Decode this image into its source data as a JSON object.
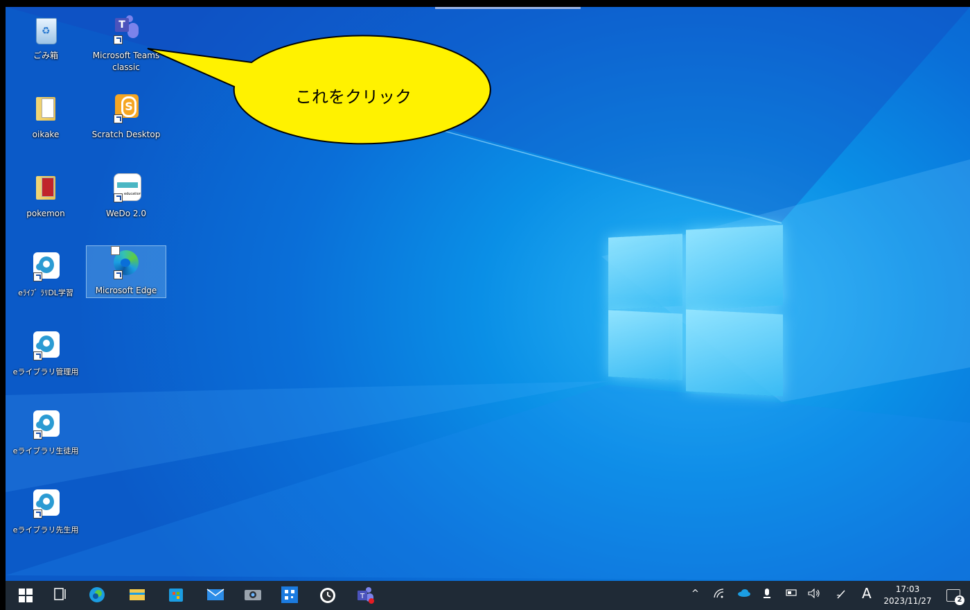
{
  "desktop": {
    "icons": [
      {
        "label": "ごみ箱"
      },
      {
        "label": "Microsoft Teams classic"
      },
      {
        "label": "oikake"
      },
      {
        "label": "Scratch Desktop"
      },
      {
        "label": "pokemon"
      },
      {
        "label": "WeDo 2.0"
      },
      {
        "label": "eﾗｲﾌﾞ ﾗﾘDL学習"
      },
      {
        "label": "Microsoft Edge"
      },
      {
        "label": "eライブラリ管理用"
      },
      {
        "label": "eライブラリ生徒用"
      },
      {
        "label": "eライブラリ先生用"
      }
    ],
    "wedo_badge": "education"
  },
  "callout": {
    "text": "これをクリック"
  },
  "taskbar": {
    "pinned": [
      "start-icon",
      "task-view-icon",
      "edge-icon",
      "file-explorer-icon",
      "store-icon",
      "mail-icon",
      "camera-icon",
      "qr-icon",
      "clock-app-icon",
      "teams-icon"
    ],
    "tray": {
      "chevron": "^",
      "ime": "A",
      "time": "17:03",
      "date": "2023/11/27",
      "notification_count": "2"
    }
  },
  "colors": {
    "taskbar": "#1f2a36",
    "callout_fill": "#fff200",
    "desktop_blue": "#0a6fd8"
  }
}
